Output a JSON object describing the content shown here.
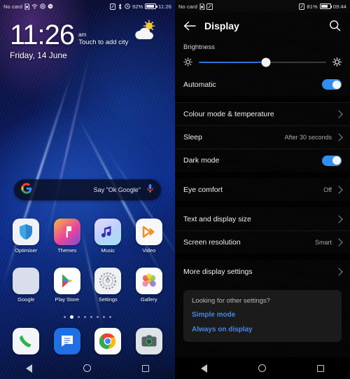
{
  "home": {
    "status_bar": {
      "carrier": "No card",
      "left_icons": [
        "sim-icon",
        "wifi-icon",
        "at-icon",
        "phone-circle-icon"
      ],
      "right_icons": [
        "nfc-icon",
        "bluetooth-icon",
        "alarm-icon"
      ],
      "battery_percent": "92%",
      "time": "11:26"
    },
    "clock_widget": {
      "time": "11:26",
      "ampm": "am",
      "city_hint": "Touch to add city",
      "date": "Friday, 14 June",
      "weather_icon": "partly-cloudy-icon"
    },
    "search": {
      "logo": "G",
      "hint": "Say \"Ok Google\"",
      "mic_icon": "microphone-icon"
    },
    "apps_row1": [
      {
        "label": "Optimiser",
        "icon": "shield-icon",
        "bg": "#eef2f7",
        "fg": "#3ea6e8"
      },
      {
        "label": "Themes",
        "icon": "brush-icon",
        "bg": "#e84393",
        "fg": "#ffffff"
      },
      {
        "label": "Music",
        "icon": "music-note-icon",
        "bg": "#ccd9fb",
        "fg": "#3b2fb0"
      },
      {
        "label": "Video",
        "icon": "play-arrow-icon",
        "bg": "#f6f7fa",
        "fg": "#f09020"
      }
    ],
    "apps_row2": [
      {
        "label": "Google",
        "icon": "folder-icon",
        "bg": "#ebeef5",
        "fg": "#444444"
      },
      {
        "label": "Play Store",
        "icon": "play-store-icon",
        "bg": "#ffffff",
        "fg": "#34a853"
      },
      {
        "label": "Settings",
        "icon": "gear-icon",
        "bg": "#f1f2f5",
        "fg": "#8d9099"
      },
      {
        "label": "Gallery",
        "icon": "gallery-flower-icon",
        "bg": "#fafafa",
        "fg": "#f7b32b"
      }
    ],
    "dock": [
      {
        "label": "",
        "icon": "phone-icon",
        "bg": "#f4f5f8",
        "fg": "#2ba84a"
      },
      {
        "label": "",
        "icon": "messages-icon",
        "bg": "#1f6fe5",
        "fg": "#ffffff"
      },
      {
        "label": "",
        "icon": "chrome-icon",
        "bg": "#fafafa",
        "fg": "#4285f4"
      },
      {
        "label": "",
        "icon": "camera-icon",
        "bg": "#dfe4e8",
        "fg": "#4f5a5f"
      }
    ],
    "page_dots": {
      "count": 8,
      "active_index": 1
    },
    "nav_bar": {
      "back": "back-icon",
      "home": "home-icon",
      "recents": "recents-icon"
    }
  },
  "settings": {
    "status_bar": {
      "carrier": "No card",
      "left_icons": [
        "sim-icon",
        "nfc-icon"
      ],
      "right_icons": [
        "nfc-icon"
      ],
      "battery_percent": "81%",
      "time": "09:44"
    },
    "app_bar": {
      "back_icon": "back-arrow-icon",
      "title": "Display",
      "search_icon": "search-icon"
    },
    "brightness": {
      "section_label": "Brightness",
      "low_icon": "brightness-low-icon",
      "high_icon": "brightness-high-icon",
      "value_percent": 53
    },
    "automatic": {
      "label": "Automatic",
      "toggle": "on"
    },
    "items": [
      {
        "label": "Colour mode & temperature",
        "value": "",
        "type": "chevron"
      },
      {
        "label": "Sleep",
        "value": "After 30 seconds",
        "type": "chevron"
      },
      {
        "label": "Dark mode",
        "value": "",
        "type": "toggle",
        "toggle": "on"
      }
    ],
    "items_group2": [
      {
        "label": "Eye comfort",
        "value": "Off",
        "type": "chevron"
      }
    ],
    "items_group3": [
      {
        "label": "Text and display size",
        "value": "",
        "type": "chevron"
      },
      {
        "label": "Screen resolution",
        "value": "Smart",
        "type": "chevron"
      }
    ],
    "items_group4": [
      {
        "label": "More display settings",
        "value": "",
        "type": "chevron"
      }
    ],
    "other_settings_card": {
      "title": "Looking for other settings?",
      "links": [
        "Simple mode",
        "Always on display"
      ]
    },
    "nav_bar": {
      "back": "back-icon",
      "home": "home-icon",
      "recents": "recents-icon"
    }
  },
  "colors": {
    "accent_blue": "#2f8ef0",
    "slider_blue": "#2f6fe0",
    "link_blue": "#3d8ae5",
    "settings_bg": "#050505"
  }
}
